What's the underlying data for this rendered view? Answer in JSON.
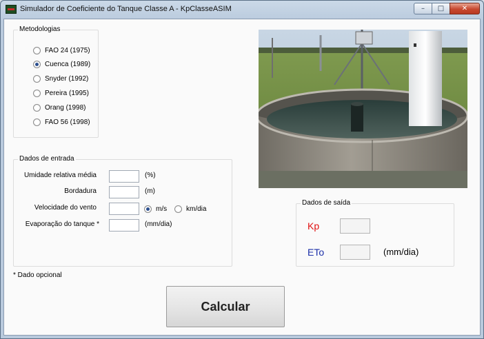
{
  "window": {
    "title": "Simulador de Coeficiente do Tanque Classe A - KpClasseASIM",
    "min_glyph": "–",
    "max_glyph": "□",
    "close_glyph": "✕"
  },
  "metodologias": {
    "title": "Metodologias",
    "options": [
      {
        "label": "FAO 24 (1975)",
        "checked": false
      },
      {
        "label": "Cuenca (1989)",
        "checked": true
      },
      {
        "label": "Snyder (1992)",
        "checked": false
      },
      {
        "label": "Pereira (1995)",
        "checked": false
      },
      {
        "label": "Orang (1998)",
        "checked": false
      },
      {
        "label": "FAO 56 (1998)",
        "checked": false
      }
    ]
  },
  "entrada": {
    "title": "Dados de entrada",
    "fields": [
      {
        "label": "Umidade relativa média",
        "unit": "(%)",
        "value": ""
      },
      {
        "label": "Bordadura",
        "unit": "(m)",
        "value": ""
      },
      {
        "label": "Velocidade do vento",
        "unit": "",
        "value": ""
      },
      {
        "label": "Evaporação do tanque  *",
        "unit": "(mm/dia)",
        "value": ""
      }
    ],
    "wind_units": [
      {
        "label": "m/s",
        "checked": true
      },
      {
        "label": "km/dia",
        "checked": false
      }
    ]
  },
  "saida": {
    "title": "Dados de saída",
    "kp_label": "Kp",
    "eto_label": "ETo",
    "eto_unit": "(mm/dia)",
    "kp_color": "#e01010",
    "eto_color": "#1a2ea8"
  },
  "footnote": "* Dado opcional",
  "calc_button": "Calcular"
}
